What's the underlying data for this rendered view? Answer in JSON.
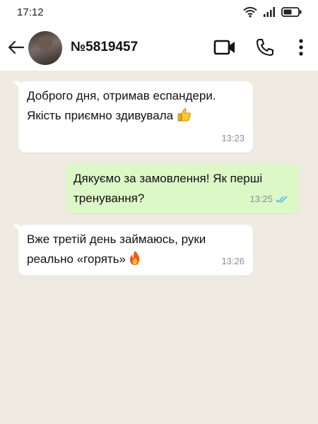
{
  "status_bar": {
    "time": "17:12",
    "icons": [
      "wifi-icon",
      "signal-icon",
      "battery-icon"
    ]
  },
  "header": {
    "back_icon": "arrow-left-icon",
    "contact_name": "№5819457",
    "actions": [
      "video-call-icon",
      "phone-icon",
      "more-vert-icon"
    ]
  },
  "messages": [
    {
      "direction": "incoming",
      "text": "Доброго дня, отримав еспандери. Якість приємно здивувала",
      "emoji": "thumbs-up-icon",
      "time": "13:23"
    },
    {
      "direction": "outgoing",
      "text": "Дякуємо за замовлення! Як перші тренування?",
      "time": "13:25",
      "status": "read"
    },
    {
      "direction": "incoming",
      "text": "Вже третій день займаюсь, руки реально «горять»",
      "emoji": "fire-icon",
      "time": "13:26"
    }
  ],
  "colors": {
    "chat_background": "#efeae2",
    "incoming_bubble": "#ffffff",
    "outgoing_bubble": "#dcf8c6",
    "read_ticks": "#4fb6ec"
  }
}
